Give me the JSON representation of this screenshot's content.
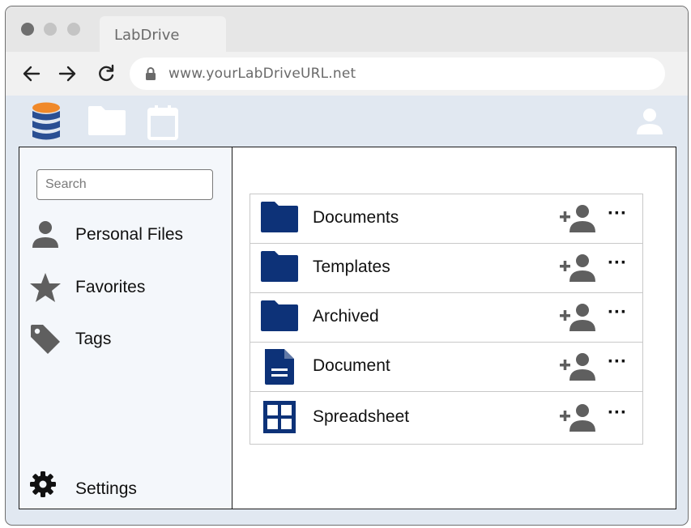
{
  "browser": {
    "tab_title": "LabDrive",
    "url": "www.yourLabDriveURL.net"
  },
  "toolbar": {
    "icons": [
      "database-icon",
      "folder-icon",
      "calendar-icon",
      "user-icon"
    ]
  },
  "sidebar": {
    "search_placeholder": "Search",
    "items": [
      {
        "label": "Personal Files",
        "icon": "person-icon"
      },
      {
        "label": "Favorites",
        "icon": "star-icon"
      },
      {
        "label": "Tags",
        "icon": "tag-icon"
      }
    ],
    "settings_label": "Settings"
  },
  "files": [
    {
      "name": "Documents",
      "icon": "folder-icon"
    },
    {
      "name": "Templates",
      "icon": "folder-icon"
    },
    {
      "name": "Archived",
      "icon": "folder-icon"
    },
    {
      "name": "Document",
      "icon": "document-icon"
    },
    {
      "name": "Spreadsheet",
      "icon": "spreadsheet-icon"
    }
  ],
  "colors": {
    "brand_blue": "#0d3278",
    "db_orange": "#f0892a",
    "db_blue": "#2a4f93",
    "icon_gray": "#5f5f5f"
  }
}
